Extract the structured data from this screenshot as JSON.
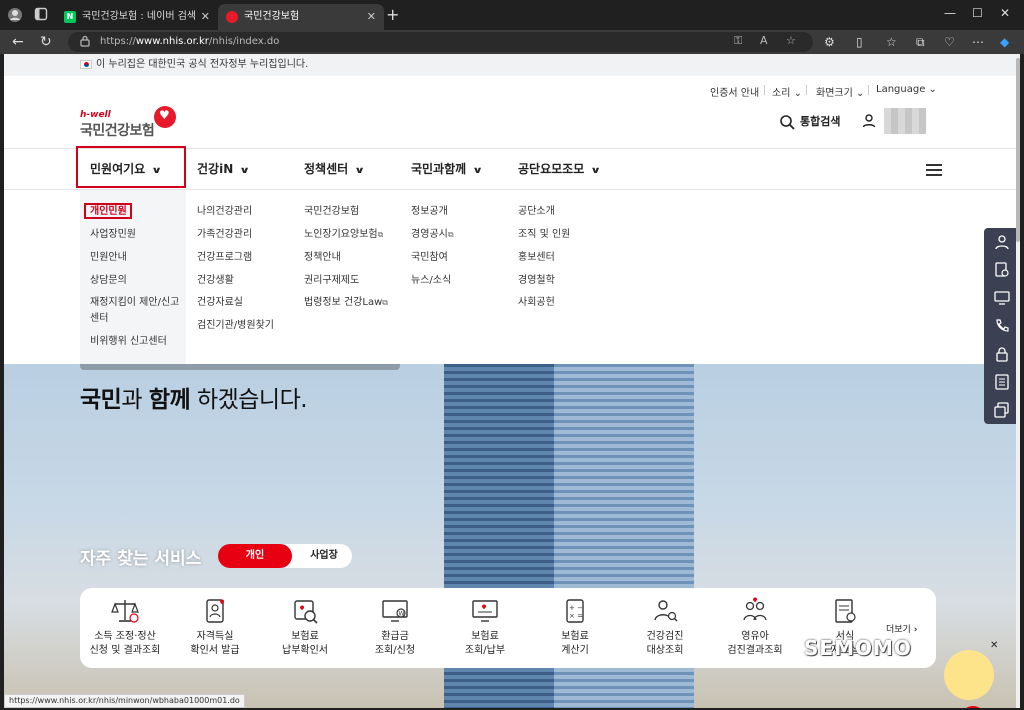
{
  "browser": {
    "tabs": [
      {
        "title": "국민건강보험 : 네이버 검색",
        "active": false
      },
      {
        "title": "국민건강보험",
        "active": true
      }
    ],
    "url_prefix": "https://",
    "url_host": "www.nhis.or.kr",
    "url_path": "/nhis/index.do",
    "status_url": "https://www.nhis.or.kr/nhis/minwon/wbhaba01000m01.do"
  },
  "gov_banner": "이 누리집은 대한민국 공식 전자정부 누리집입니다.",
  "util_links": [
    "인증서 안내",
    "소리",
    "화면크기",
    "Language"
  ],
  "logo": {
    "tagline": "h-well",
    "name": "국민건강보험"
  },
  "header": {
    "search_label": "통합검색"
  },
  "gnb": [
    {
      "label": "민원여기요",
      "highlighted": true
    },
    {
      "label": "건강iN"
    },
    {
      "label": "정책센터"
    },
    {
      "label": "국민과함께"
    },
    {
      "label": "공단요모조모"
    }
  ],
  "submenu": {
    "col1": [
      "개인민원",
      "사업장민원",
      "민원안내",
      "상담문의",
      "재정지킴이 제안/신고",
      "센터",
      "비위행위 신고센터"
    ],
    "col2": [
      "나의건강관리",
      "가족건강관리",
      "건강프로그램",
      "건강생활",
      "건강자료실",
      "검진기관/병원찾기"
    ],
    "col3": [
      "국민건강보험",
      "노인장기요양보험",
      "정책안내",
      "권리구제제도",
      "법령정보 건강Law"
    ],
    "col4": [
      "정보공개",
      "경영공시",
      "국민참여",
      "뉴스/소식"
    ],
    "col5": [
      "공단소개",
      "조직 및 인원",
      "홍보센터",
      "경영철학",
      "사회공헌"
    ]
  },
  "hero": {
    "title_bold1": "국민",
    "title_mid": "과 ",
    "title_bold2": "함께",
    "title_end": " 하겠습니다."
  },
  "quick_services": {
    "title": "자주 찾는 서비스",
    "toggle_on": "개인",
    "toggle_off": "사업장",
    "items": [
      {
        "line1": "소득 조정·정산",
        "line2": "신청 및 결과조회",
        "icon": "scale-icon"
      },
      {
        "line1": "자격득실",
        "line2": "확인서 발급",
        "icon": "id-card-icon"
      },
      {
        "line1": "보험료",
        "line2": "납부확인서",
        "icon": "receipt-search-icon"
      },
      {
        "line1": "환급금",
        "line2": "조회/신청",
        "icon": "monitor-won-icon"
      },
      {
        "line1": "보험료",
        "line2": "조회/납부",
        "icon": "monitor-check-icon"
      },
      {
        "line1": "보험료",
        "line2": "계산기",
        "icon": "calculator-icon"
      },
      {
        "line1": "건강검진",
        "line2": "대상조회",
        "icon": "people-search-icon"
      },
      {
        "line1": "영유아",
        "line2": "검진결과조회",
        "icon": "family-icon"
      },
      {
        "line1": "서식",
        "line2": "자료실",
        "icon": "document-icon"
      }
    ],
    "more_label": "더보기"
  },
  "watermark": "SEMOMO"
}
